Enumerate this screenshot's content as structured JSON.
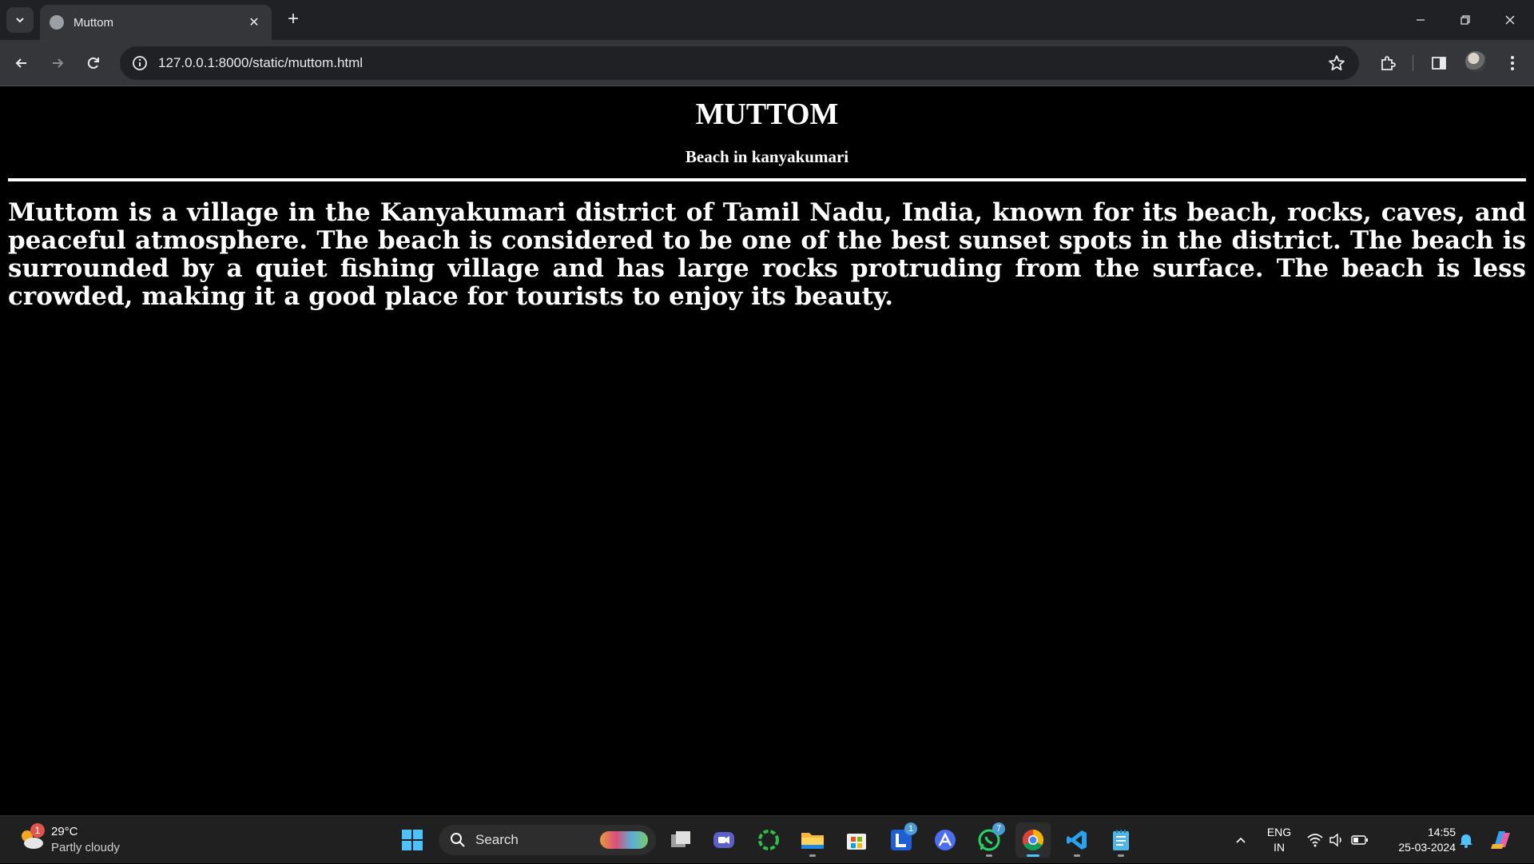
{
  "browser": {
    "tab_title": "Muttom",
    "url": "127.0.0.1:8000/static/muttom.html"
  },
  "page": {
    "heading": "MUTTOM",
    "subheading": "Beach in kanyakumari",
    "paragraph": "Muttom is a village in the Kanyakumari district of Tamil Nadu, India, known for its beach, rocks, caves, and peaceful atmosphere. The beach is considered to be one of the best sunset spots in the district. The beach is surrounded by a quiet fishing village and has large rocks protruding from the surface. The beach is less crowded, making it a good place for tourists to enjoy its beauty."
  },
  "taskbar": {
    "weather": {
      "badge": "1",
      "temperature": "29°C",
      "condition": "Partly cloudy"
    },
    "search_label": "Search",
    "badges": {
      "lockdown": "1",
      "whatsapp": "7"
    },
    "language": {
      "line1": "ENG",
      "line2": "IN"
    },
    "clock": {
      "time": "14:55",
      "date": "25-03-2024"
    }
  },
  "icons": {
    "tab_search": "chevron-down-icon",
    "favicon": "globe-icon",
    "tab_close": "close-icon",
    "new_tab": "plus-icon",
    "back": "arrow-left-icon",
    "forward": "arrow-right-icon",
    "reload": "reload-icon",
    "site_info": "info-icon",
    "bookmark": "star-icon",
    "extensions": "puzzle-icon",
    "side_panel": "side-panel-icon",
    "menu": "more-vertical-icon"
  },
  "colors": {
    "page_background": "#000000",
    "page_text": "#ffffff",
    "chrome_dark": "#202124",
    "chrome_toolbar": "#35363a",
    "taskbar": "#202020"
  }
}
